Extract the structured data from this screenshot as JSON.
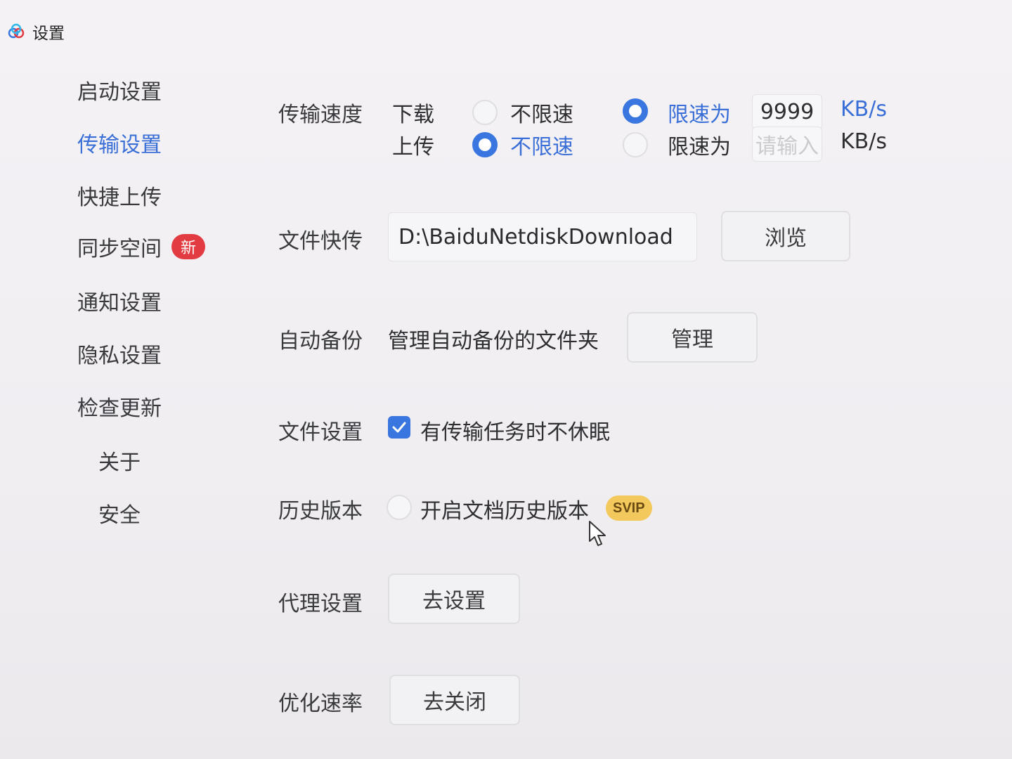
{
  "window": {
    "title": "设置"
  },
  "sidebar": {
    "items": [
      {
        "label": "启动设置"
      },
      {
        "label": "传输设置",
        "active": true
      },
      {
        "label": "快捷上传"
      },
      {
        "label": "同步空间",
        "badge": "新"
      },
      {
        "label": "通知设置"
      },
      {
        "label": "隐私设置"
      },
      {
        "label": "检查更新"
      },
      {
        "label": "关于"
      },
      {
        "label": "安全"
      }
    ]
  },
  "transfer_speed": {
    "label": "传输速度",
    "download": {
      "label": "下载",
      "unlimited_label": "不限速",
      "limit_label": "限速为",
      "selected": "limit",
      "value": "9999",
      "unit": "KB/s"
    },
    "upload": {
      "label": "上传",
      "unlimited_label": "不限速",
      "limit_label": "限速为",
      "selected": "unlimited",
      "placeholder": "请输入",
      "unit": "KB/s"
    }
  },
  "file_transfer": {
    "label": "文件快传",
    "path": "D:\\BaiduNetdiskDownload",
    "browse_label": "浏览"
  },
  "auto_backup": {
    "label": "自动备份",
    "description": "管理自动备份的文件夹",
    "manage_label": "管理"
  },
  "file_settings": {
    "label": "文件设置",
    "no_sleep_label": "有传输任务时不休眠",
    "no_sleep_checked": true
  },
  "history": {
    "label": "历史版本",
    "enable_label": "开启文档历史版本",
    "badge": "SVIP",
    "enabled": false
  },
  "proxy": {
    "label": "代理设置",
    "button_label": "去设置"
  },
  "optimize": {
    "label": "优化速率",
    "button_label": "去关闭"
  },
  "colors": {
    "accent": "#3a76e0",
    "active_text": "#3a6fd8",
    "badge_red": "#e23b41",
    "svip_gold": "#f3c95e"
  }
}
